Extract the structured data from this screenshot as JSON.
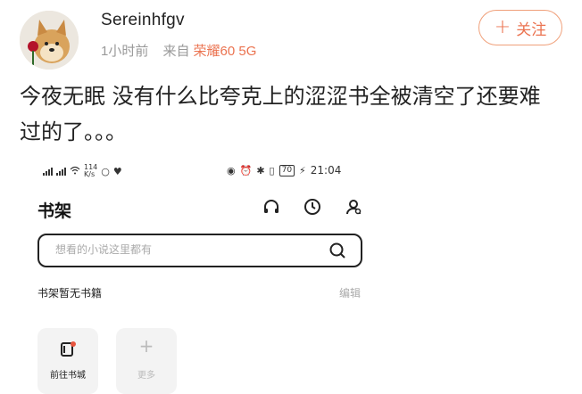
{
  "post": {
    "username": "Sereinhfgv",
    "time": "1小时前",
    "source_prefix": "来自",
    "device": "荣耀60 5G",
    "follow_label": "关注",
    "text": "今夜无眠 没有什么比夸克上的涩涩书全被清空了还要难过的了。。。"
  },
  "screenshot": {
    "statusbar": {
      "speed": "114",
      "speed_unit": "K/s",
      "battery": "70",
      "time": "21:04"
    },
    "title": "书架",
    "search_placeholder": "想看的小说这里都有",
    "empty_text": "书架暂无书籍",
    "edit_label": "编辑",
    "tiles": [
      {
        "label": "前往书城"
      },
      {
        "label": "更多"
      }
    ]
  },
  "colors": {
    "accent": "#eb7350",
    "meta_gray": "#999999"
  }
}
